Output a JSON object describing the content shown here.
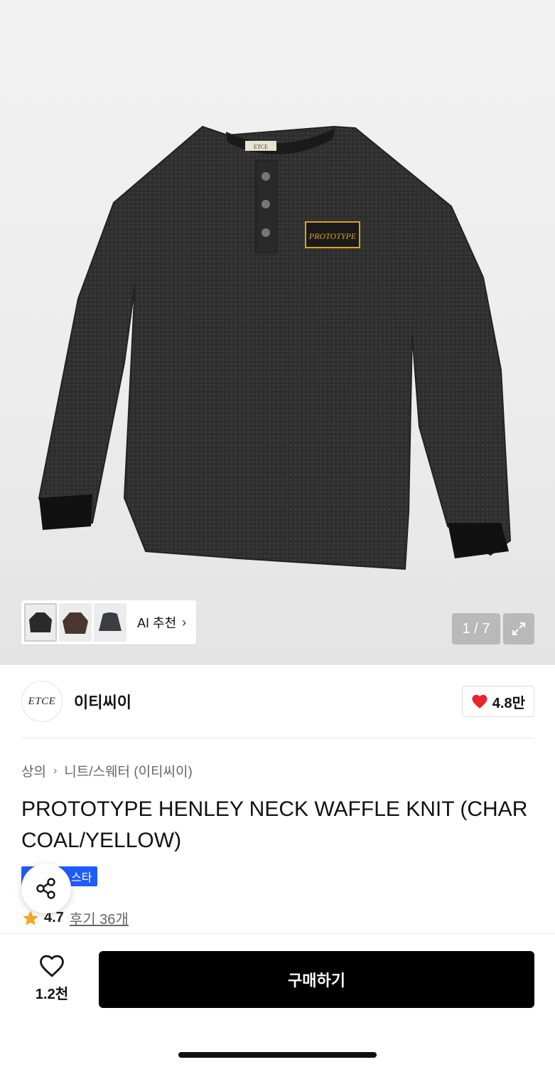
{
  "gallery": {
    "ai_label": "AI 추천",
    "counter": "1 / 7"
  },
  "brand": {
    "logo_text": "ETCE",
    "name": "이티씨이",
    "likes": "4.8만"
  },
  "breadcrumb": {
    "level1": "상의",
    "level2": "니트/스웨터 (이티씨이)"
  },
  "product": {
    "title": "PROTOTYPE HENLEY NECK WAFFLE KNIT (CHARCOAL/YELLOW)",
    "badge": "스타",
    "rating": "4.7",
    "reviews": "후기 36개",
    "patch_text": "PROTOTYPE",
    "collar_label": "ETCE"
  },
  "bottom_bar": {
    "wishlist_count": "1.2천",
    "buy_label": "구매하기"
  },
  "colors": {
    "accent_blue": "#1f5cff",
    "heart_red": "#e8252a",
    "star_orange": "#f5a623",
    "garment": "#2a2a2a",
    "patch_yellow": "#d9a520"
  }
}
